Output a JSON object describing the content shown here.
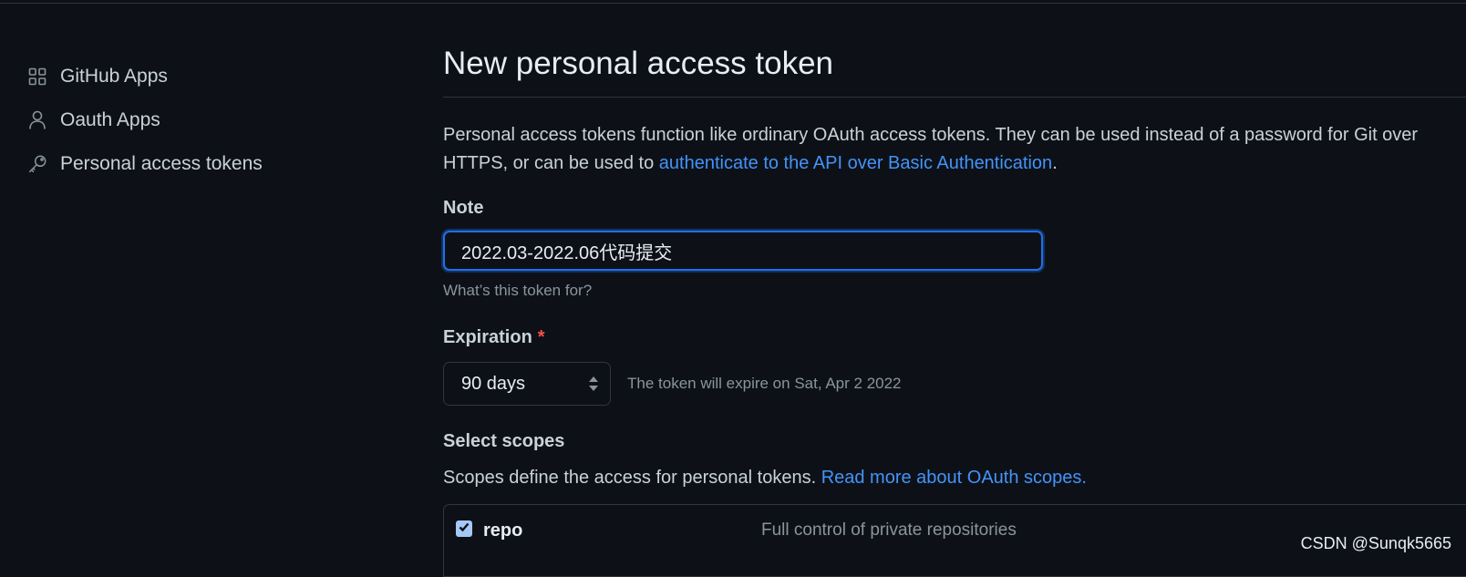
{
  "sidebar": {
    "items": [
      {
        "label": "GitHub Apps",
        "icon": "apps-grid-icon"
      },
      {
        "label": "Oauth Apps",
        "icon": "person-icon"
      },
      {
        "label": "Personal access tokens",
        "icon": "key-icon"
      }
    ]
  },
  "main": {
    "title": "New personal access token",
    "intro_text": "Personal access tokens function like ordinary OAuth access tokens. They can be used instead of a password for Git over HTTPS, or can be used to ",
    "intro_link": "authenticate to the API over Basic Authentication",
    "intro_end": ".",
    "note": {
      "label": "Note",
      "value": "2022.03-2022.06代码提交",
      "hint": "What’s this token for?"
    },
    "expiration": {
      "label": "Expiration",
      "required_mark": "*",
      "selected": "90 days",
      "note": "The token will expire on Sat, Apr 2 2022"
    },
    "scopes": {
      "label": "Select scopes",
      "description": "Scopes define the access for personal tokens. ",
      "link": "Read more about OAuth scopes.",
      "items": [
        {
          "name": "repo",
          "checked": true,
          "description": "Full control of private repositories"
        }
      ]
    }
  },
  "watermark": "CSDN @Sunqk5665",
  "colors": {
    "background": "#0d1117",
    "link": "#4493f8",
    "focus_border": "#1f6feb",
    "required": "#f85149"
  }
}
